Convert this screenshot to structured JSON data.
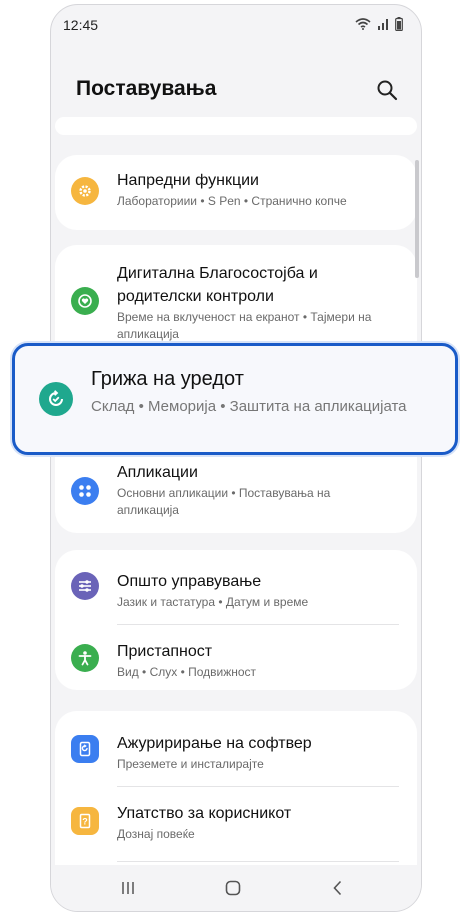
{
  "status_bar": {
    "time": "12:45"
  },
  "header": {
    "title": "Поставувања"
  },
  "items": {
    "advanced": {
      "title": "Напредни функции",
      "subtitle": "Лабораториии  •  S Pen  •  Странично копче"
    },
    "wellbeing": {
      "title_line1": "Дигитална Благосостојба и",
      "title_line2": "родителски контроли",
      "subtitle": "Време на вклученост на екранот  •  Тајмери на апликација"
    },
    "device_care": {
      "title": "Грижа на уредот",
      "subtitle": "Склад  •  Меморија  •  Заштита на апликацијата"
    },
    "apps": {
      "title": "Апликации",
      "subtitle": "Основни апликации  •  Поставувања на апликација"
    },
    "general": {
      "title": "Општо управување",
      "subtitle": "Јазик и тастатура  •  Датум и време"
    },
    "accessibility": {
      "title": "Пристапност",
      "subtitle": "Вид  •  Слух  •  Подвижност"
    },
    "software_update": {
      "title": "Ажуририрање на софтвер",
      "subtitle": "Преземете и инсталирајте"
    },
    "user_manual": {
      "title": "Упатство за корисникот",
      "subtitle": "Дознај повеќе"
    }
  },
  "colors": {
    "advanced_icon": "#f6b63f",
    "wellbeing_icon": "#3aae4f",
    "device_care_icon": "#1fa88e",
    "apps_icon": "#3b7ef0",
    "general_icon": "#6a63b8",
    "accessibility_icon": "#3aae4f",
    "software_update_icon": "#3b7ef0",
    "user_manual_icon": "#f6b63f",
    "highlight_border": "#1a5bc8"
  }
}
